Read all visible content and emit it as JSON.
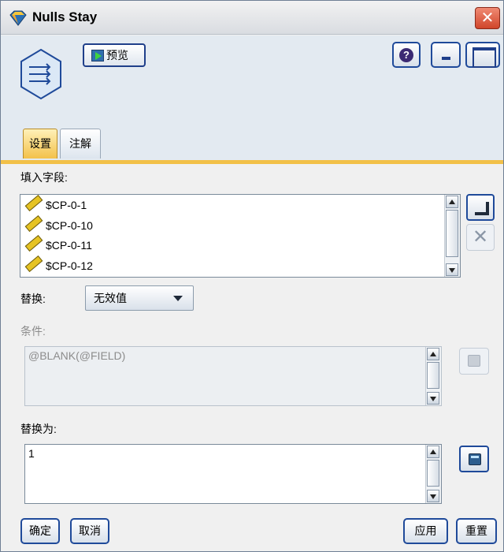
{
  "window": {
    "title": "Nulls Stay",
    "close_glyph": "✕"
  },
  "toolbar": {
    "preview_label": "预览",
    "help_glyph": "?"
  },
  "tabs": [
    {
      "label": "设置",
      "active": true
    },
    {
      "label": "注解",
      "active": false
    }
  ],
  "fill_fields": {
    "label": "填入字段:",
    "items": [
      "$CP-0-1",
      "$CP-0-10",
      "$CP-0-11",
      "$CP-0-12"
    ],
    "icon": "ruler-icon"
  },
  "replace": {
    "label": "替换:",
    "selected": "无效值"
  },
  "condition": {
    "label": "条件:",
    "value": "@BLANK(@FIELD)"
  },
  "replace_with": {
    "label": "替换为:",
    "value": "1"
  },
  "buttons": {
    "ok": "确定",
    "cancel": "取消",
    "apply": "应用",
    "reset": "重置",
    "delete_glyph": "✕"
  },
  "colors": {
    "accent_tab": "#f2c048",
    "button_border": "#1f4a9a",
    "header_bg": "#e3eaf1"
  }
}
